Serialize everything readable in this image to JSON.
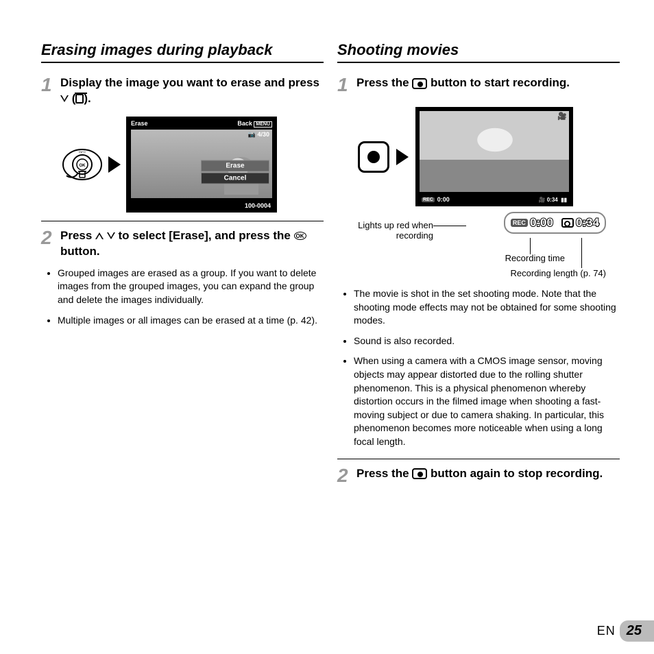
{
  "left": {
    "title": "Erasing images during playback",
    "step1": {
      "num": "1",
      "text_a": "Display the image you want to erase and press ",
      "text_b": " (",
      "text_c": ")."
    },
    "screen": {
      "erase_label": "Erase",
      "back_label": "Back",
      "menu_label": "MENU",
      "counter": "4/30",
      "opt_erase": "Erase",
      "opt_cancel": "Cancel",
      "folio": "100-0004"
    },
    "step2": {
      "num": "2",
      "text_a": "Press ",
      "text_b": " to select [Erase], and press the ",
      "text_c": " button."
    },
    "bullets": [
      "Grouped images are erased as a group. If you want to delete images from the grouped images, you can expand the group and delete the images individually.",
      "Multiple images or all images can be erased at a time (p. 42)."
    ]
  },
  "right": {
    "title": "Shooting movies",
    "step1": {
      "num": "1",
      "text_a": "Press the ",
      "text_b": " button to start recording."
    },
    "screen": {
      "rec_label": "REC",
      "time": "0:00",
      "remain": "0:34"
    },
    "zoom": {
      "rec": "REC",
      "t1": "0:00",
      "t2": "0:34"
    },
    "labels": {
      "lights": "Lights up red when recording",
      "rectime": "Recording time",
      "reclen": "Recording length (p. 74)"
    },
    "bullets": [
      "The movie is shot in the set shooting mode. Note that the shooting mode effects may not be obtained for some shooting modes.",
      "Sound is also recorded.",
      "When using a camera with a CMOS image sensor, moving objects may appear distorted due to the rolling shutter phenomenon. This is a physical phenomenon whereby distortion occurs in the filmed image when shooting a fast-moving subject or due to camera shaking. In particular, this phenomenon becomes more noticeable when using a long focal length."
    ],
    "step2": {
      "num": "2",
      "text_a": "Press the ",
      "text_b": " button again to stop recording."
    }
  },
  "footer": {
    "lang": "EN",
    "page": "25"
  },
  "ok_label": "OK"
}
